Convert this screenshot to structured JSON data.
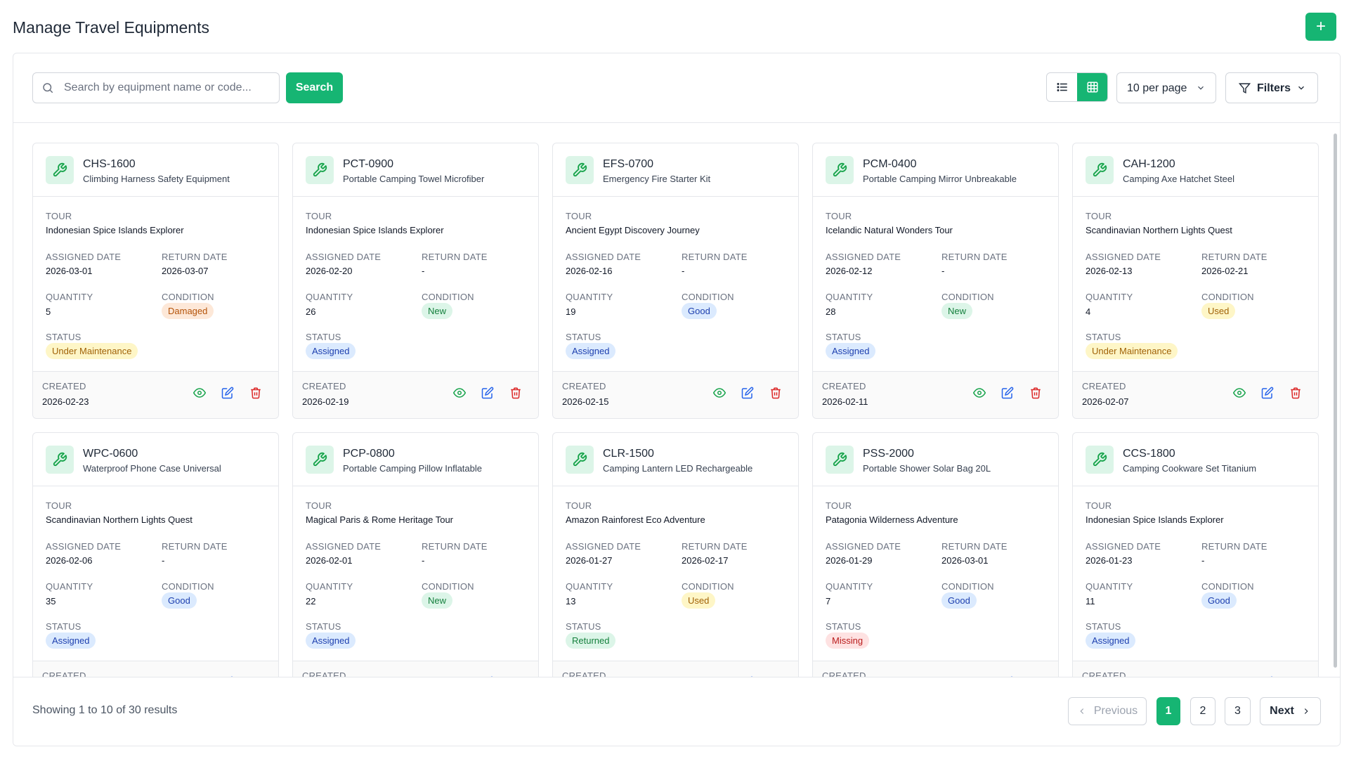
{
  "page": {
    "title": "Manage Travel Equipments",
    "add_label": "+"
  },
  "toolbar": {
    "search_placeholder": "Search by equipment name or code...",
    "search_value": "",
    "search_button": "Search",
    "per_page": "10 per page",
    "filters_label": "Filters",
    "view_mode": "grid"
  },
  "labels": {
    "tour": "TOUR",
    "assigned_date": "ASSIGNED DATE",
    "return_date": "RETURN DATE",
    "quantity": "QUANTITY",
    "condition": "CONDITION",
    "status": "STATUS",
    "created": "CREATED"
  },
  "cards": [
    {
      "code": "CHS-1600",
      "name": "Climbing Harness Safety Equipment",
      "tour": "Indonesian Spice Islands Explorer",
      "assigned_date": "2026-03-01",
      "return_date": "2026-03-07",
      "quantity": "5",
      "condition": "Damaged",
      "status": "Under Maintenance",
      "created": "2026-02-23"
    },
    {
      "code": "PCT-0900",
      "name": "Portable Camping Towel Microfiber",
      "tour": "Indonesian Spice Islands Explorer",
      "assigned_date": "2026-02-20",
      "return_date": "-",
      "quantity": "26",
      "condition": "New",
      "status": "Assigned",
      "created": "2026-02-19"
    },
    {
      "code": "EFS-0700",
      "name": "Emergency Fire Starter Kit",
      "tour": "Ancient Egypt Discovery Journey",
      "assigned_date": "2026-02-16",
      "return_date": "-",
      "quantity": "19",
      "condition": "Good",
      "status": "Assigned",
      "created": "2026-02-15"
    },
    {
      "code": "PCM-0400",
      "name": "Portable Camping Mirror Unbreakable",
      "tour": "Icelandic Natural Wonders Tour",
      "assigned_date": "2026-02-12",
      "return_date": "-",
      "quantity": "28",
      "condition": "New",
      "status": "Assigned",
      "created": "2026-02-11"
    },
    {
      "code": "CAH-1200",
      "name": "Camping Axe Hatchet Steel",
      "tour": "Scandinavian Northern Lights Quest",
      "assigned_date": "2026-02-13",
      "return_date": "2026-02-21",
      "quantity": "4",
      "condition": "Used",
      "status": "Under Maintenance",
      "created": "2026-02-07"
    },
    {
      "code": "WPC-0600",
      "name": "Waterproof Phone Case Universal",
      "tour": "Scandinavian Northern Lights Quest",
      "assigned_date": "2026-02-06",
      "return_date": "-",
      "quantity": "35",
      "condition": "Good",
      "status": "Assigned",
      "created": ""
    },
    {
      "code": "PCP-0800",
      "name": "Portable Camping Pillow Inflatable",
      "tour": "Magical Paris & Rome Heritage Tour",
      "assigned_date": "2026-02-01",
      "return_date": "-",
      "quantity": "22",
      "condition": "New",
      "status": "Assigned",
      "created": ""
    },
    {
      "code": "CLR-1500",
      "name": "Camping Lantern LED Rechargeable",
      "tour": "Amazon Rainforest Eco Adventure",
      "assigned_date": "2026-01-27",
      "return_date": "2026-02-17",
      "quantity": "13",
      "condition": "Used",
      "status": "Returned",
      "created": ""
    },
    {
      "code": "PSS-2000",
      "name": "Portable Shower Solar Bag 20L",
      "tour": "Patagonia Wilderness Adventure",
      "assigned_date": "2026-01-29",
      "return_date": "2026-03-01",
      "quantity": "7",
      "condition": "Good",
      "status": "Missing",
      "created": ""
    },
    {
      "code": "CCS-1800",
      "name": "Camping Cookware Set Titanium",
      "tour": "Indonesian Spice Islands Explorer",
      "assigned_date": "2026-01-23",
      "return_date": "-",
      "quantity": "11",
      "condition": "Good",
      "status": "Assigned",
      "created": ""
    }
  ],
  "pagination": {
    "info": "Showing 1 to 10 of 30 results",
    "previous": "Previous",
    "next": "Next",
    "pages": [
      "1",
      "2",
      "3"
    ],
    "current": "1"
  },
  "colors": {
    "accent": "#16b573",
    "danger": "#dc2626",
    "edit": "#2563eb"
  }
}
